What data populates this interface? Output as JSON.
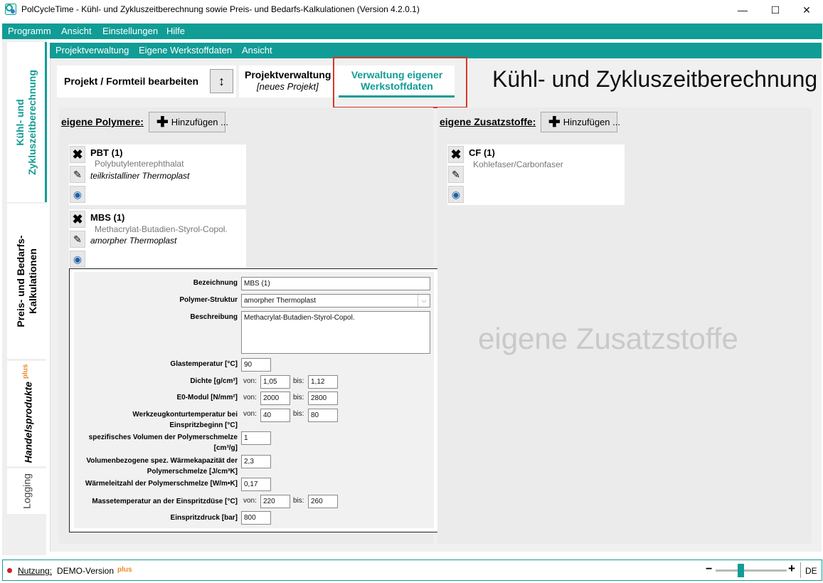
{
  "window": {
    "title": "PolCycleTime - Kühl- und Zykluszeitberechnung sowie Preis- und Bedarfs-Kalkulationen (Version 4.2.0.1)",
    "minimize": "—",
    "maximize": "☐",
    "close": "✕"
  },
  "menu": [
    "Programm",
    "Ansicht",
    "Einstellungen",
    "Hilfe"
  ],
  "left_tabs": {
    "tab1": "Kühl- und Zykluszeitberechnung",
    "tab1_line1": "Kühl- und",
    "tab1_line2": "Zykluszeitberechnung",
    "tab2_line1": "Preis- und Bedarfs-",
    "tab2_line2": "Kalkulationen",
    "tab3": "Handelsprodukte",
    "tab3_badge": "plus",
    "tab4": "Logging"
  },
  "submenu": [
    "Projektverwaltung",
    "Eigene Werkstoffdaten",
    "Ansicht"
  ],
  "header": {
    "edit_label": "Projekt / Formteil bearbeiten",
    "toggle_icon": "↕",
    "proj_title": "Projektverwaltung",
    "proj_sub": "[neues Projekt]",
    "active_tab_line1": "Verwaltung eigener",
    "active_tab_line2": "Werkstoffdaten",
    "big_title": "Kühl- und Zykluszeitberechnung"
  },
  "polymers": {
    "heading": "eigene Polymere:",
    "add_label": "Hinzufügen ...",
    "items": [
      {
        "name": "PBT (1)",
        "desc": "Polybutylenterephthalat",
        "type": "teilkristalliner Thermoplast"
      },
      {
        "name": "MBS (1)",
        "desc": "Methacrylat-Butadien-Styrol-Copol.",
        "type": "amorpher Thermoplast"
      }
    ]
  },
  "additives": {
    "heading": "eigene Zusatzstoffe:",
    "add_label": "Hinzufügen ...",
    "items": [
      {
        "name": "CF (1)",
        "desc": "Kohlefaser/Carbonfaser"
      }
    ],
    "watermark": "eigene Zusatzstoffe"
  },
  "form": {
    "von": "von:",
    "bis": "bis:",
    "bezeichnung": {
      "label": "Bezeichnung",
      "value": "MBS (1)"
    },
    "struktur": {
      "label": "Polymer-Struktur",
      "value": "amorpher Thermoplast"
    },
    "beschreibung": {
      "label": "Beschreibung",
      "value": "Methacrylat-Butadien-Styrol-Copol."
    },
    "glas": {
      "label": "Glastemperatur [°C]",
      "value": "90"
    },
    "dichte": {
      "label": "Dichte [g/cm³]",
      "von": "1,05",
      "bis": "1,12"
    },
    "e0": {
      "label": "E0-Modul [N/mm²]",
      "von": "2000",
      "bis": "2800"
    },
    "wkt": {
      "label1": "Werkzeugkonturtemperatur bei",
      "label2": "Einspritzbeginn [°C]",
      "von": "40",
      "bis": "80"
    },
    "spezvol": {
      "label1": "spezifisches Volumen der Polymerschmelze",
      "label2": "[cm³/g]",
      "value": "1"
    },
    "waermekap": {
      "label1": "Volumenbezogene spez. Wärmekapazität der",
      "label2": "Polymerschmelze [J/cm³K]",
      "value": "2,3"
    },
    "waermeleit": {
      "label": "Wärmeleitzahl der Polymerschmelze [W/m•K]",
      "value": "0,17"
    },
    "massetemp": {
      "label": "Massetemperatur an der Einspritzdüse [°C]",
      "von": "220",
      "bis": "260"
    },
    "druck": {
      "label": "Einspritzdruck [bar]",
      "value": "800"
    }
  },
  "status": {
    "label": "Nutzung:",
    "value": "DEMO-Version",
    "badge": "plus",
    "zoom_minus": "−",
    "zoom_plus": "+",
    "zoom_level_fraction": 0.35,
    "language": "DE"
  },
  "colors": {
    "accent": "#119c96",
    "highlight": "#d9342b",
    "badge": "#e8892c"
  }
}
